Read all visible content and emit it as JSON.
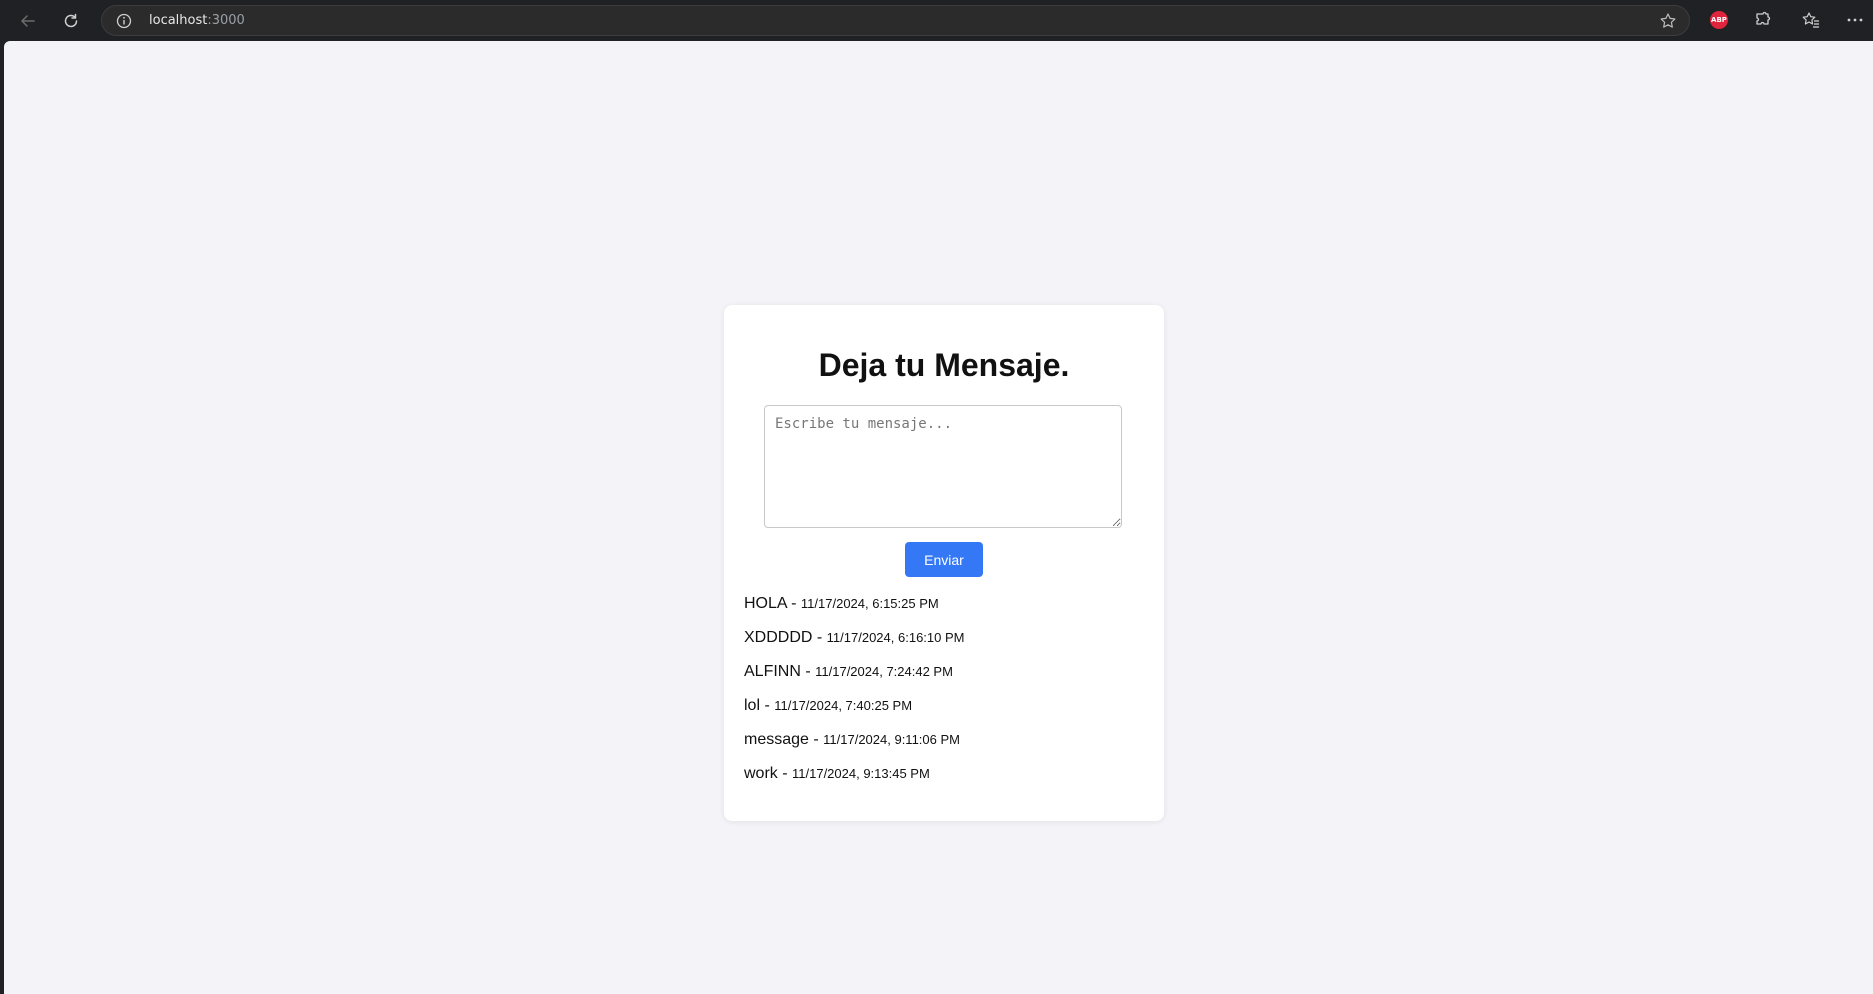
{
  "browser": {
    "url_host": "localhost",
    "url_port": ":3000",
    "abp_label": "ABP"
  },
  "page": {
    "title": "Deja tu Mensaje.",
    "textarea_placeholder": "Escribe tu mensaje...",
    "send_label": "Enviar",
    "separator": " - ",
    "messages": [
      {
        "text": "HOLA",
        "timestamp": "11/17/2024, 6:15:25 PM"
      },
      {
        "text": "XDDDDD",
        "timestamp": "11/17/2024, 6:16:10 PM"
      },
      {
        "text": "ALFINN",
        "timestamp": "11/17/2024, 7:24:42 PM"
      },
      {
        "text": "lol",
        "timestamp": "11/17/2024, 7:40:25 PM"
      },
      {
        "text": "message",
        "timestamp": "11/17/2024, 9:11:06 PM"
      },
      {
        "text": "work",
        "timestamp": "11/17/2024, 9:13:45 PM"
      }
    ]
  },
  "colors": {
    "accent": "#3478f6",
    "page_bg": "#f4f4f8",
    "card_bg": "#ffffff",
    "chrome_bg": "#202124",
    "abp": "#e0243b"
  }
}
